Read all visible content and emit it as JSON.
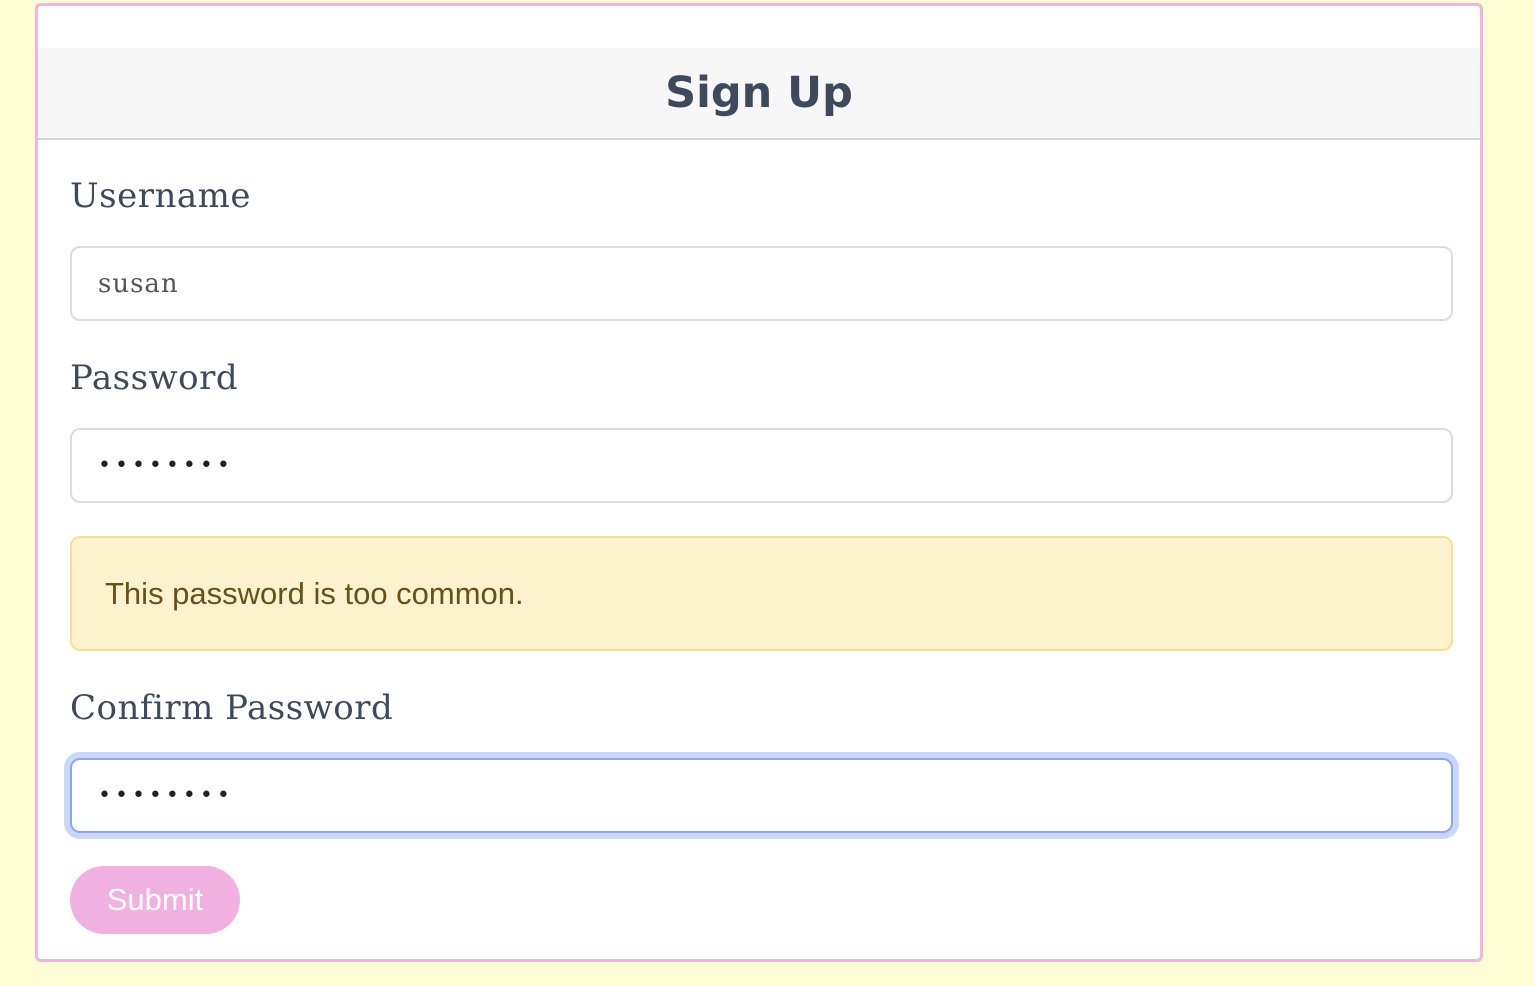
{
  "form": {
    "title": "Sign Up",
    "username": {
      "label": "Username",
      "value": "susan"
    },
    "password": {
      "label": "Password",
      "value": "••••••••"
    },
    "alert": {
      "text": "This password is too common.",
      "background_color": "#fdf2ce",
      "text_color": "#66511b"
    },
    "confirm_password": {
      "label": "Confirm Password",
      "value": "••••••••"
    },
    "submit_label": "Submit",
    "accent_color": "#f1b1e0",
    "page_background": "#fffdd4"
  }
}
